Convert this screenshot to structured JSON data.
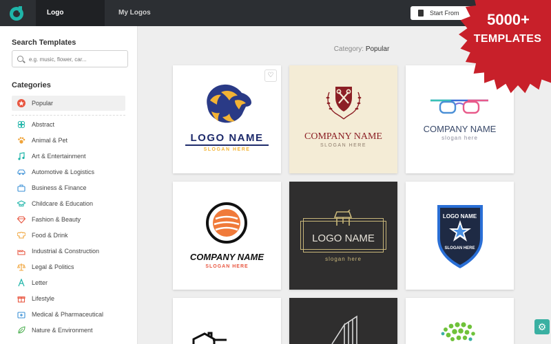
{
  "topbar": {
    "tabs": [
      {
        "label": "Logo Templates",
        "active": true
      },
      {
        "label": "My Logos",
        "active": false
      }
    ],
    "start_button": "Start From",
    "brand_color": "#1fb5a9"
  },
  "badge": {
    "line1": "5000+",
    "line2": "TEMPLATES",
    "color": "#c8202a"
  },
  "sidebar": {
    "search_title": "Search Templates",
    "search_placeholder": "e.g. music, flower, car...",
    "categories_title": "Categories",
    "selected": {
      "label": "Popular",
      "icon": "star-icon"
    },
    "items": [
      {
        "label": "Abstract",
        "icon": "abstract-icon"
      },
      {
        "label": "Animal & Pet",
        "icon": "paw-icon"
      },
      {
        "label": "Art & Entertainment",
        "icon": "music-note-icon"
      },
      {
        "label": "Automotive & Logistics",
        "icon": "car-icon"
      },
      {
        "label": "Business & Finance",
        "icon": "briefcase-icon"
      },
      {
        "label": "Childcare & Education",
        "icon": "graduation-cap-icon"
      },
      {
        "label": "Fashion & Beauty",
        "icon": "diamond-icon"
      },
      {
        "label": "Food & Drink",
        "icon": "chef-hat-icon"
      },
      {
        "label": "Industrial & Construction",
        "icon": "factory-icon"
      },
      {
        "label": "Legal & Politics",
        "icon": "scales-icon"
      },
      {
        "label": "Letter",
        "icon": "letter-a-icon"
      },
      {
        "label": "Lifestyle",
        "icon": "gift-icon"
      },
      {
        "label": "Medical & Pharmaceutical",
        "icon": "medical-kit-icon"
      },
      {
        "label": "Nature & Environment",
        "icon": "leaf-icon"
      }
    ]
  },
  "main": {
    "category_prefix": "Category:",
    "category_name": "Popular",
    "cards": [
      {
        "name": "LOGO NAME",
        "slogan": "SLOGAN HERE"
      },
      {
        "name": "COMPANY NAME",
        "slogan": "SLOGAN HERE"
      },
      {
        "name": "COMPANY NAME",
        "slogan": "slogan here"
      },
      {
        "name": "COMPANY NAME",
        "slogan": "SLOGAN HERE"
      },
      {
        "name": "LOGO NAME",
        "slogan": "slogan here"
      },
      {
        "name": "LOGO NAME",
        "slogan": "SLOGAN HERE"
      }
    ]
  }
}
